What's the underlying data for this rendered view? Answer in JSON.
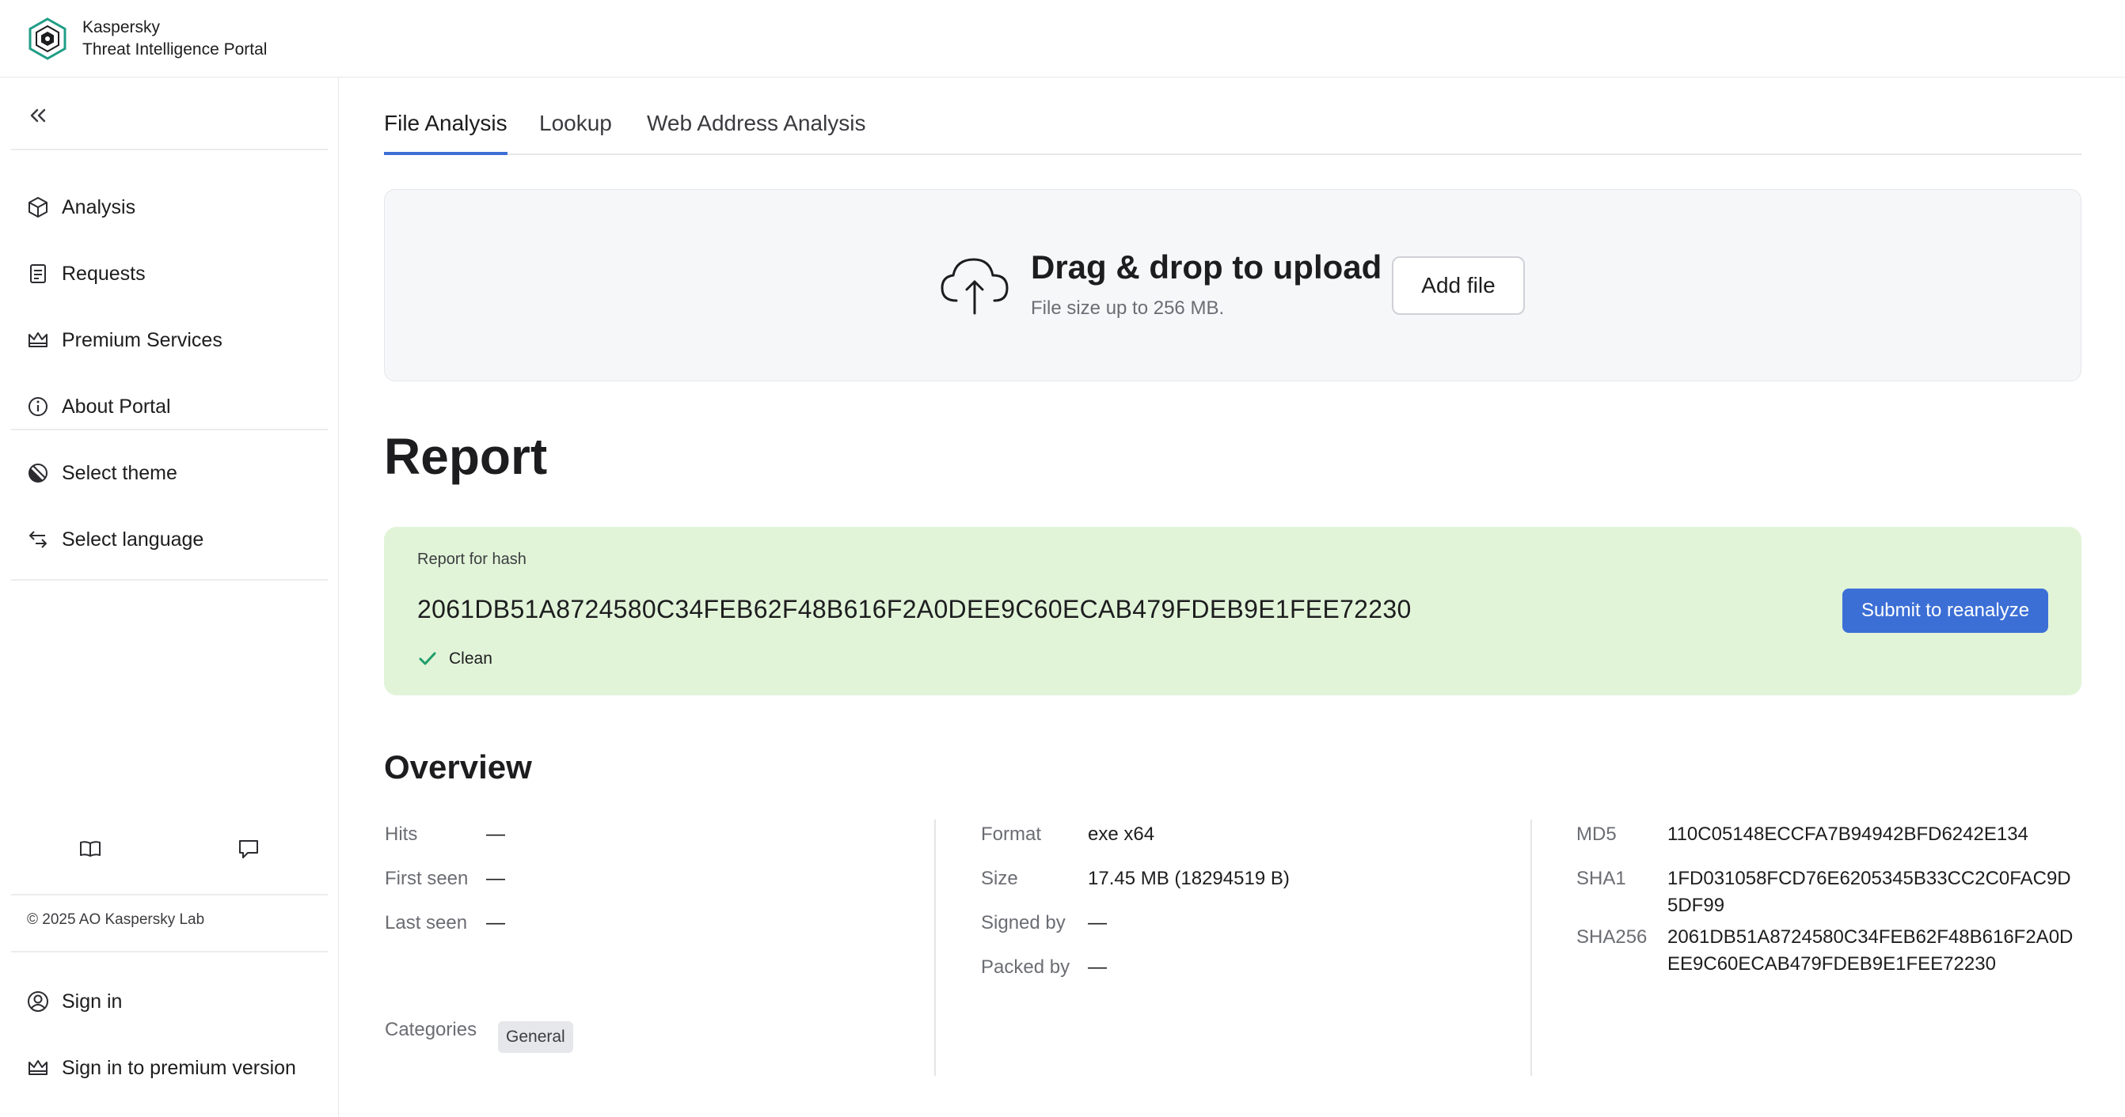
{
  "header": {
    "brand_line1": "Kaspersky",
    "brand_line2": "Threat Intelligence Portal"
  },
  "sidebar": {
    "collapse_icon": "chevrons-left-icon",
    "items": [
      {
        "label": "Analysis",
        "icon": "cube-icon"
      },
      {
        "label": "Requests",
        "icon": "document-icon"
      },
      {
        "label": "Premium Services",
        "icon": "crown-icon"
      },
      {
        "label": "About Portal",
        "icon": "info-icon"
      },
      {
        "label": "Select theme",
        "icon": "theme-icon"
      },
      {
        "label": "Select language",
        "icon": "language-icon"
      }
    ],
    "footer_icons": [
      "book-icon",
      "chat-icon"
    ],
    "copyright": "© 2025 AO Kaspersky Lab",
    "account": [
      {
        "label": "Sign in",
        "icon": "user-circle-icon"
      },
      {
        "label": "Sign in to premium version",
        "icon": "crown-icon"
      }
    ]
  },
  "tabs": [
    {
      "label": "File Analysis",
      "active": true
    },
    {
      "label": "Lookup",
      "active": false
    },
    {
      "label": "Web Address Analysis",
      "active": false
    }
  ],
  "upload": {
    "title": "Drag & drop to upload",
    "subtitle": "File size up to 256 MB.",
    "button": "Add file",
    "icon": "cloud-upload-icon"
  },
  "report": {
    "title": "Report",
    "hash_label": "Report for hash",
    "hash": "2061DB51A8724580C34FEB62F48B616F2A0DEE9C60ECAB479FDEB9E1FEE72230",
    "verdict": "Clean",
    "verdict_color": "#1f9d6b",
    "card_color": "#e1f4d8",
    "reanalyze_button": "Submit to reanalyze",
    "accent": "#3c6fd6"
  },
  "overview": {
    "title": "Overview",
    "col1": [
      {
        "key": "Hits",
        "value": "—"
      },
      {
        "key": "First seen",
        "value": "—"
      },
      {
        "key": "Last seen",
        "value": "—"
      }
    ],
    "col2": [
      {
        "key": "Format",
        "value": "exe x64"
      },
      {
        "key": "Size",
        "value": "17.45 MB (18294519 B)"
      },
      {
        "key": "Signed by",
        "value": "—"
      },
      {
        "key": "Packed by",
        "value": "—"
      }
    ],
    "col3": [
      {
        "key": "MD5",
        "value": "110C05148ECCFA7B94942BFD6242E134"
      },
      {
        "key": "SHA1",
        "value": "1FD031058FCD76E6205345B33CC2C0FAC9D5DF99"
      },
      {
        "key": "SHA256",
        "value": "2061DB51A8724580C34FEB62F48B616F2A0DEE9C60ECAB479FDEB9E1FEE72230"
      }
    ],
    "categories_label": "Categories",
    "categories": [
      "General"
    ]
  }
}
